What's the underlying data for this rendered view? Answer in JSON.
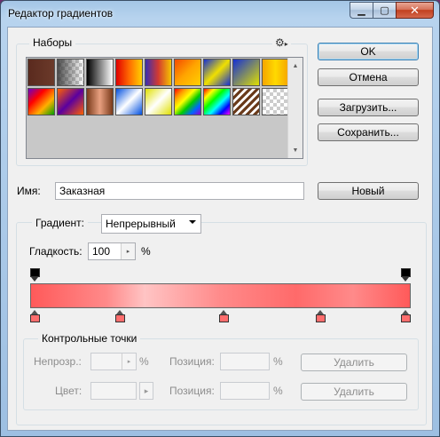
{
  "window": {
    "title": "Редактор градиентов",
    "min_glyph": "▁",
    "max_glyph": "▢",
    "close_glyph": "✕"
  },
  "buttons": {
    "ok": "OK",
    "cancel": "Отмена",
    "load": "Загрузить...",
    "save": "Сохранить...",
    "new": "Новый"
  },
  "presets": {
    "label": "Наборы",
    "menu_icon": "⚙",
    "menu_caret": "▸",
    "scroll_up": "▲",
    "scroll_down": "▼",
    "swatches": [
      "linear-gradient(90deg,#5a2a1e,#6b3a2a)",
      "checker-dark",
      "linear-gradient(90deg,#000,#fff)",
      "linear-gradient(90deg,#e00000,#ff6a00,#ffd000)",
      "linear-gradient(90deg,#3a2fb0,#d43a2f,#f5c400)",
      "linear-gradient(135deg,#f54a00,#ffa500,#ffd000)",
      "linear-gradient(135deg,#1530d4,#f0e000,#1530d4)",
      "linear-gradient(135deg,#1530d4,#e0e000)",
      "linear-gradient(90deg,#f5a500,#ffd900,#f5a500)",
      "linear-gradient(135deg,#6a00c8,#ff0000,#ffb000,#00a000)",
      "linear-gradient(135deg,#ff6000,#5a00a0,#ff6000)",
      "linear-gradient(90deg,#7a3a1a,#e8a080,#7a3a1a)",
      "linear-gradient(135deg,#0050e0,#ffffff,#0050e0)",
      "linear-gradient(135deg,#e0e000,#ffffff,#e0e000)",
      "linear-gradient(135deg,#ff0000,#ff9900,#ffff00,#00cc00,#0066ff,#9900cc)",
      "linear-gradient(135deg,#ff0000,#ffff00,#00ff00,#00ffff,#0000ff,#ff00ff)",
      "stripes",
      "checker"
    ]
  },
  "name": {
    "label": "Имя:",
    "value": "Заказная"
  },
  "gradient": {
    "type_label": "Градиент:",
    "type_value": "Непрерывный",
    "smoothness_label": "Гладкость:",
    "smoothness_value": "100",
    "smoothness_unit": "%",
    "spin_glyph": "▸",
    "preview": "linear-gradient(90deg,#ff5a5a 0%,#ff8a8a 20%,#ffc4c4 30%,#ff8a8a 50%,#ff6a6a 70%,#ff8a8a 85%,#ff5a5a 100%)",
    "opacity_stop_color": "#000000",
    "color_stop_color": "#ff6e6e",
    "opacity_stops": [
      0,
      100
    ],
    "color_stops": [
      0,
      23,
      51,
      77,
      100
    ]
  },
  "stops": {
    "group_label": "Контрольные точки",
    "opacity_label": "Непрозр.:",
    "opacity_unit": "%",
    "position_label_1": "Позиция:",
    "position_unit_1": "%",
    "delete_1": "Удалить",
    "color_label": "Цвет:",
    "position_label_2": "Позиция:",
    "position_unit_2": "%",
    "delete_2": "Удалить",
    "spin_glyph": "▸"
  }
}
